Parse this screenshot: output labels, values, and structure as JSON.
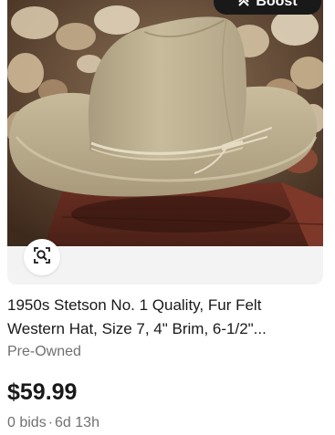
{
  "listing": {
    "image_alt": "1950s Stetson No. 1 Quality Fur Felt Western Hat",
    "boost_label": "Boost",
    "boost_icon": "chevron-double-up-icon",
    "visual_search_icon": "image-search-icon",
    "title": "1950s Stetson No. 1 Quality, Fur Felt Western Hat, Size 7, 4\" Brim, 6-1/2\"...",
    "condition": "Pre-Owned",
    "price": "$59.99",
    "bids": "0 bids",
    "separator": "·",
    "time_left": "6d 13h"
  },
  "colors": {
    "felt": "#c3b596",
    "band": "#e6dcc4",
    "boost_bg": "#191919",
    "text_primary": "#191919",
    "text_secondary": "#707070"
  }
}
